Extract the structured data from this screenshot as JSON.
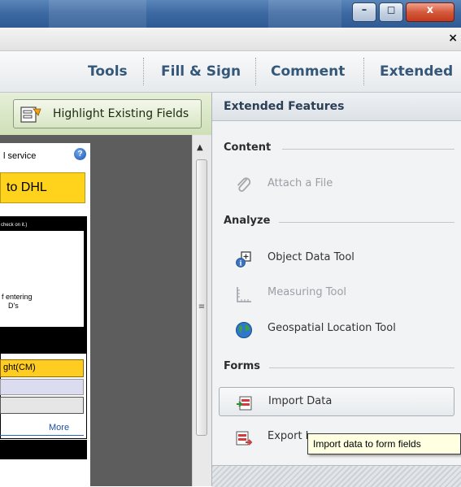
{
  "window": {
    "minimize": "–",
    "restore": "◻",
    "close": "x"
  },
  "menubar": {
    "close_document": "×"
  },
  "toolbar": {
    "tools": "Tools",
    "fill_sign": "Fill & Sign",
    "comment": "Comment",
    "extended": "Extended"
  },
  "highlight_button": {
    "label": "Highlight Existing Fields"
  },
  "document": {
    "service_text": "l service",
    "help_glyph": "?",
    "banner_text": "to DHL",
    "check_text": "check on it.)",
    "entering_line1": "f entering",
    "entering_line2": "D's",
    "field_label": "ght(CM)",
    "more_link": "More"
  },
  "panel": {
    "title": "Extended Features",
    "sections": {
      "content": "Content",
      "analyze": "Analyze",
      "forms": "Forms"
    },
    "items": {
      "attach_file": "Attach a File",
      "object_data_tool": "Object Data Tool",
      "measuring_tool": "Measuring Tool",
      "geospatial_tool": "Geospatial Location Tool",
      "import_data": "Import Data",
      "export_data": "Export I"
    }
  },
  "tooltip": {
    "text": "Import data to form fields"
  },
  "icons": {
    "attach": "paperclip-icon",
    "object_data": "object-data-icon",
    "measuring": "ruler-icon",
    "geospatial": "globe-icon",
    "import": "import-data-icon",
    "export": "export-data-icon",
    "highlight": "highlight-fields-icon",
    "help": "help-icon"
  },
  "colors": {
    "titlebar": "#3e6aa3",
    "toolbar_text": "#35577a",
    "highlight_bar": "#cfe0b8",
    "dhl_yellow": "#ffd21c",
    "tooltip_bg": "#ffffe1"
  }
}
